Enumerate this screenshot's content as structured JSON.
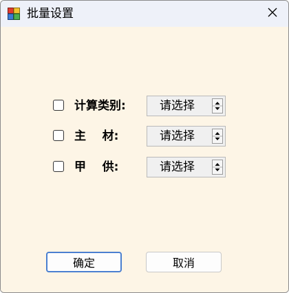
{
  "window": {
    "title": "批量设置",
    "close_glyph": "✕"
  },
  "form": {
    "rows": [
      {
        "label": "计算类别:",
        "checked": false,
        "value": "请选择"
      },
      {
        "label": "主    材:",
        "checked": false,
        "value": "请选择"
      },
      {
        "label": "甲    供:",
        "checked": false,
        "value": "请选择"
      }
    ]
  },
  "buttons": {
    "ok_label": "确定",
    "cancel_label": "取消"
  },
  "colors": {
    "client_bg": "#fdf5e6",
    "titlebar_bg": "#eef1f9",
    "default_button_border": "#4a7fd0"
  },
  "icons": {
    "app": "app-icon",
    "close": "close-icon",
    "spinner": "up-down-arrow-icon"
  }
}
